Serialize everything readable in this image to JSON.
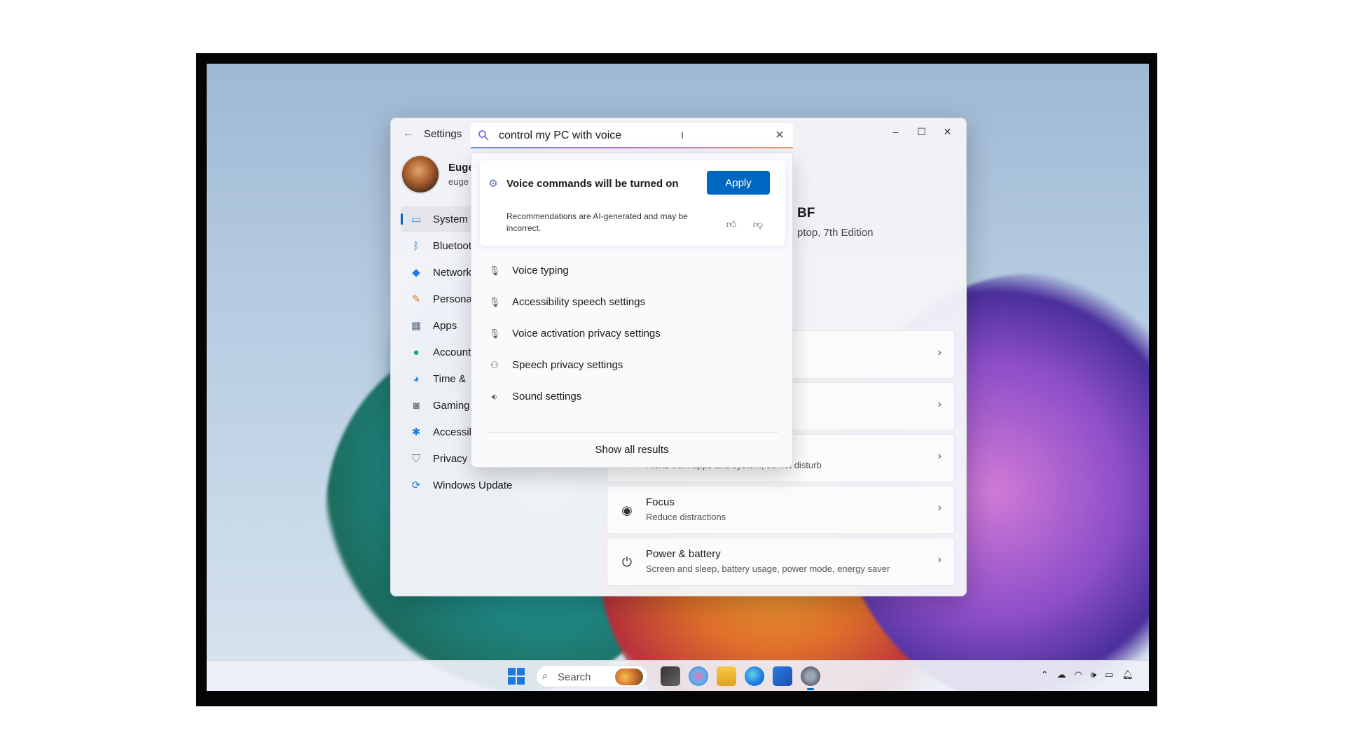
{
  "window": {
    "title": "Settings",
    "back_glyph": "←",
    "minimize_glyph": "–",
    "maximize_glyph": "☐",
    "close_glyph": "✕"
  },
  "search": {
    "value": "control my PC with voice",
    "caret_glyph": "I",
    "clear_glyph": "✕"
  },
  "profile": {
    "name": "Euge",
    "email": "euge"
  },
  "nav": {
    "items": [
      {
        "label": "System",
        "icon": "monitor-icon",
        "color": "#3a8ee6"
      },
      {
        "label": "Bluetoot",
        "icon": "bluetooth-icon",
        "color": "#1e7ae0"
      },
      {
        "label": "Network",
        "icon": "wifi-icon",
        "color": "#1e7ae0"
      },
      {
        "label": "Personal",
        "icon": "brush-icon",
        "color": "#d9822b"
      },
      {
        "label": "Apps",
        "icon": "apps-icon",
        "color": "#5a6a88"
      },
      {
        "label": "Account",
        "icon": "person-icon",
        "color": "#23a36b"
      },
      {
        "label": "Time &",
        "icon": "globe-clock-icon",
        "color": "#2f8fd8"
      },
      {
        "label": "Gaming",
        "icon": "gamepad-icon",
        "color": "#6b7280"
      },
      {
        "label": "Accessib",
        "icon": "accessibility-icon",
        "color": "#1e7ae0"
      },
      {
        "label": "Privacy & security",
        "icon": "shield-icon",
        "color": "#7b8190"
      },
      {
        "label": "Windows Update",
        "icon": "update-icon",
        "color": "#1e7ae0"
      }
    ]
  },
  "device": {
    "name": "BF",
    "model": "ptop, 7th Edition"
  },
  "cards": [
    {
      "title": "",
      "desc": ", display profile",
      "icon": ""
    },
    {
      "title": "",
      "desc": "nd devices",
      "icon": ""
    },
    {
      "title": "Notifications",
      "desc": "Alerts from apps and system, do not disturb",
      "icon": "bell-icon"
    },
    {
      "title": "Focus",
      "desc": "Reduce distractions",
      "icon": "focus-icon"
    },
    {
      "title": "Power & battery",
      "desc": "Screen and sleep, battery usage, power mode, energy saver",
      "icon": "power-icon"
    }
  ],
  "suggestion": {
    "title": "Voice commands will be turned on",
    "apply_label": "Apply",
    "note": "Recommendations are AI-generated and may be incorrect."
  },
  "results": [
    {
      "label": "Voice typing",
      "icon": "microphone-icon"
    },
    {
      "label": "Accessibility speech settings",
      "icon": "microphone-icon"
    },
    {
      "label": "Voice activation privacy settings",
      "icon": "microphone-filled-icon"
    },
    {
      "label": "Speech privacy settings",
      "icon": "speech-people-icon"
    },
    {
      "label": "Sound settings",
      "icon": "speaker-icon"
    }
  ],
  "show_all_label": "Show all results",
  "taskbar": {
    "search_placeholder": "Search"
  },
  "colors": {
    "accent": "#0067c0"
  }
}
